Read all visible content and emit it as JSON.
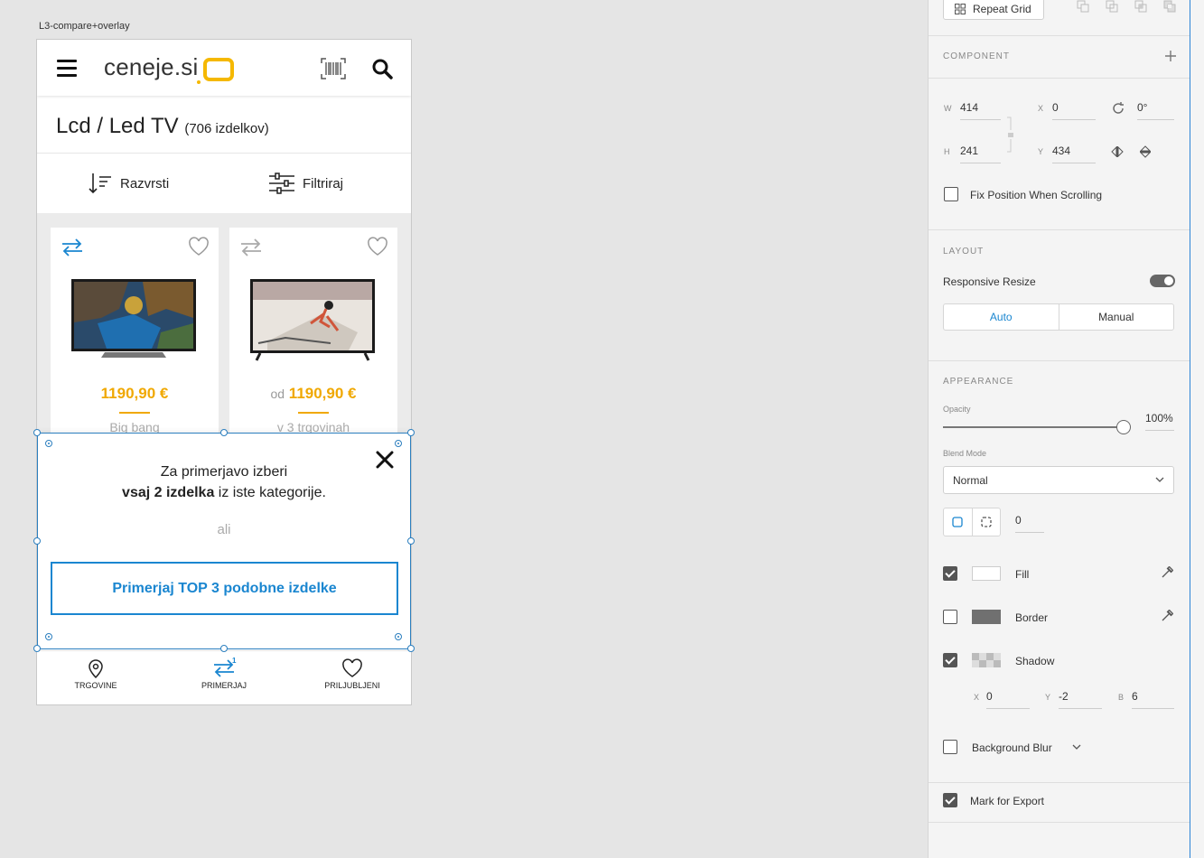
{
  "artboard": {
    "label": "L3-compare+overlay"
  },
  "phone": {
    "header": {
      "logo_text": "ceneje.si"
    },
    "title": {
      "main": "Lcd / Led TV",
      "count": "(706 izdelkov)"
    },
    "toolbar": {
      "sort_label": "Razvrsti",
      "filter_label": "Filtriraj"
    },
    "products": [
      {
        "price_prefix": "",
        "price": "1190,90 €",
        "shop": "Big bang"
      },
      {
        "price_prefix": "od",
        "price": "1190,90 €",
        "shop": "v 3 trgovinah"
      }
    ],
    "overlay": {
      "line1": "Za primerjavo izberi",
      "line2_bold": "vsaj 2 izdelka",
      "line2_rest": " iz iste kategorije.",
      "or_text": "ali",
      "cta_label": "Primerjaj TOP 3 podobne izdelke"
    },
    "bottom_nav": [
      {
        "label": "TRGOVINE",
        "icon": "map-pin-icon"
      },
      {
        "label": "PRIMERJAJ",
        "icon": "compare-arrows-icon",
        "badge": "1"
      },
      {
        "label": "PRILJUBLJENI",
        "icon": "heart-icon"
      }
    ]
  },
  "inspector": {
    "repeat_grid_label": "Repeat Grid",
    "component": {
      "title": "COMPONENT"
    },
    "transform": {
      "w_label": "W",
      "w": "414",
      "h_label": "H",
      "h": "241",
      "x_label": "X",
      "x": "0",
      "y_label": "Y",
      "y": "434",
      "rotation": "0°"
    },
    "fix_position_label": "Fix Position When Scrolling",
    "layout": {
      "title": "LAYOUT",
      "responsive_label": "Responsive Resize",
      "responsive_on": true,
      "auto_label": "Auto",
      "manual_label": "Manual"
    },
    "appearance": {
      "title": "APPEARANCE",
      "opacity_label": "Opacity",
      "opacity_value": "100%",
      "blend_label": "Blend Mode",
      "blend_value": "Normal",
      "corner_radius": "0",
      "fill_label": "Fill",
      "fill_checked": true,
      "fill_color": "#ffffff",
      "border_label": "Border",
      "border_checked": false,
      "border_color": "#707070",
      "shadow_label": "Shadow",
      "shadow_checked": true,
      "shadow_x_label": "X",
      "shadow_x": "0",
      "shadow_y_label": "Y",
      "shadow_y": "-2",
      "shadow_b_label": "B",
      "shadow_b": "6",
      "bg_blur_label": "Background Blur",
      "bg_blur_checked": false
    },
    "mark_export_label": "Mark for Export",
    "mark_export_checked": true
  },
  "colors": {
    "accent_blue": "#1a86d0",
    "price_orange": "#f0a800",
    "logo_yellow": "#f5b800"
  }
}
